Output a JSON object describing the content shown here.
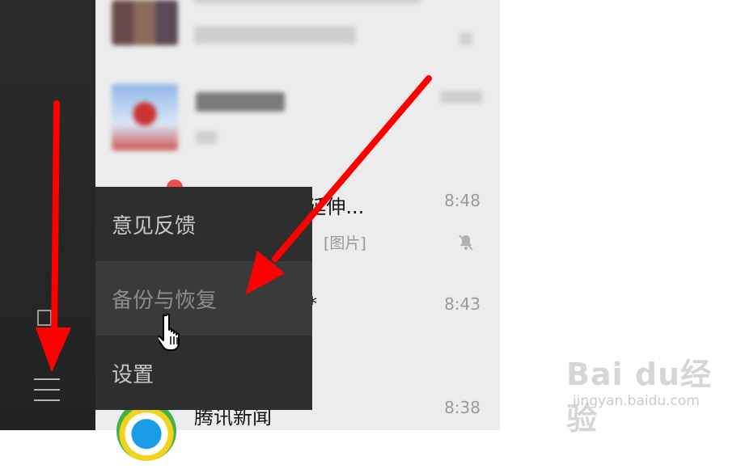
{
  "chats": [
    {
      "title": "",
      "time": "",
      "preview": ""
    },
    {
      "title": "",
      "time": "",
      "preview": ""
    },
    {
      "title": "爱--延伸...",
      "time": "8:48",
      "preview": "[图片]"
    },
    {
      "title": "*",
      "time": "8:43",
      "preview": ""
    },
    {
      "title": "腾讯新闻",
      "time": "8:38",
      "preview": ""
    }
  ],
  "menu": {
    "items": [
      {
        "label": "意见反馈"
      },
      {
        "label": "备份与恢复"
      },
      {
        "label": "设置"
      }
    ]
  },
  "watermark": {
    "logo": "Bai du经验",
    "url": "jingyan.baidu.com"
  },
  "colors": {
    "sidebar": "#262626",
    "popup": "#2e2e2e",
    "popup_hover": "#3a3a3a",
    "chatlist_bg": "#ececec",
    "arrow": "#ff0000",
    "unread_dot": "#f04a4a"
  },
  "icons": {
    "sidebar_file": "file-icon",
    "sidebar_menu": "hamburger-menu-icon",
    "mute": "bell-slash-icon",
    "cursor": "hand-pointer-icon"
  }
}
